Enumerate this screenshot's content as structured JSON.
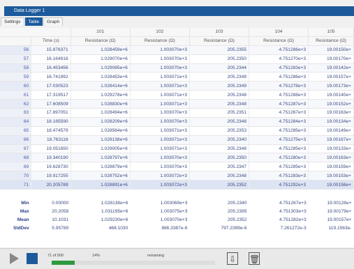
{
  "window": {
    "title": "Data Logger 1"
  },
  "tabs": [
    {
      "label": "Settings"
    },
    {
      "label": "Table"
    },
    {
      "label": "Graph"
    }
  ],
  "table": {
    "channel_headers": [
      "101",
      "102",
      "103",
      "104",
      "105"
    ],
    "column_headers": [
      "Time (s)",
      "Resistance (Ω)",
      "Resistance (Ω)",
      "Resistance (Ω)",
      "Resistance (Ω)",
      "Resistance (Ω)"
    ],
    "rows": [
      [
        "56",
        "15.876371",
        "1.028459e+6",
        "1.003070e+3",
        "205.2355",
        "4.751286e+3",
        "19.00150e+"
      ],
      [
        "57",
        "16.164916",
        "1.029070e+6",
        "1.003070e+3",
        "205.2350",
        "4.751270e+3",
        "19.00170e+"
      ],
      [
        "58",
        "16.453456",
        "1.029085e+6",
        "1.003070e+3",
        "205.2344",
        "4.751283e+3",
        "19.00142e+"
      ],
      [
        "59",
        "16.741992",
        "1.028453e+6",
        "1.003071e+3",
        "205.2349",
        "4.751286e+3",
        "19.00157e+"
      ],
      [
        "60",
        "17.030523",
        "1.028414e+6",
        "1.003071e+3",
        "205.2349",
        "4.751278e+3",
        "19.00173e+"
      ],
      [
        "61",
        "17.319517",
        "1.029278e+6",
        "1.003071e+3",
        "205.2348",
        "4.751288e+3",
        "19.00140e+"
      ],
      [
        "62",
        "17.608509",
        "1.028830e+6",
        "1.003071e+3",
        "205.2348",
        "4.751287e+3",
        "19.00152e+"
      ],
      [
        "63",
        "17.897051",
        "1.028494e+6",
        "1.003070e+3",
        "205.2351",
        "4.751267e+3",
        "19.00163e+"
      ],
      [
        "64",
        "18.185590",
        "1.028209e+6",
        "1.003070e+3",
        "205.2348",
        "4.751284e+3",
        "19.00134e+"
      ],
      [
        "65",
        "18.474579",
        "1.028564e+6",
        "1.003071e+3",
        "205.2353",
        "4.751285e+3",
        "19.00149e+"
      ],
      [
        "66",
        "18.763116",
        "1.028138e+6",
        "1.003071e+3",
        "205.2340",
        "4.751275e+3",
        "19.00167e+"
      ],
      [
        "67",
        "19.051650",
        "1.029005e+6",
        "1.003071e+3",
        "205.2348",
        "4.751285e+3",
        "19.00133e+"
      ],
      [
        "68",
        "19.340190",
        "1.028797e+6",
        "1.003070e+3",
        "205.2350",
        "4.751280e+3",
        "19.00163e+"
      ],
      [
        "69",
        "19.628730",
        "1.028879e+6",
        "1.003070e+3",
        "205.2347",
        "4.751285e+3",
        "19.00159e+"
      ],
      [
        "70",
        "19.917255",
        "1.028752e+6",
        "1.003072e+3",
        "205.2348",
        "4.751283e+3",
        "19.00153e+"
      ],
      [
        "71",
        "20.205789",
        "1.028891e+6",
        "1.003072e+3",
        "205.2352",
        "4.751292e+3",
        "19.00158e+"
      ]
    ],
    "stats": [
      [
        "Min",
        "0.00000",
        "1.028138e+6",
        "1.003069e+3",
        "205.2340",
        "4.751267e+3",
        "19.00128e+"
      ],
      [
        "Max",
        "20.2058",
        "1.031195e+6",
        "1.003075e+3",
        "205.2395",
        "4.751303e+3",
        "19.00179e+"
      ],
      [
        "Mean",
        "10.1031",
        "1.029230e+6",
        "1.003070e+3",
        "205.2352",
        "4.751282e+3",
        "19.00157e+"
      ],
      [
        "StdDev",
        "5.95789",
        "468.1030",
        "886.3387e-6",
        "797.2399e-6",
        "7.261272e-3",
        "119.1563e-"
      ]
    ]
  },
  "status": {
    "scan_count": "71 of 500",
    "percent": "14%",
    "remaining": "remaining",
    "progress": 0.14
  },
  "icons": [
    "play-icon",
    "stop-icon",
    "export-icon",
    "trash-icon"
  ]
}
